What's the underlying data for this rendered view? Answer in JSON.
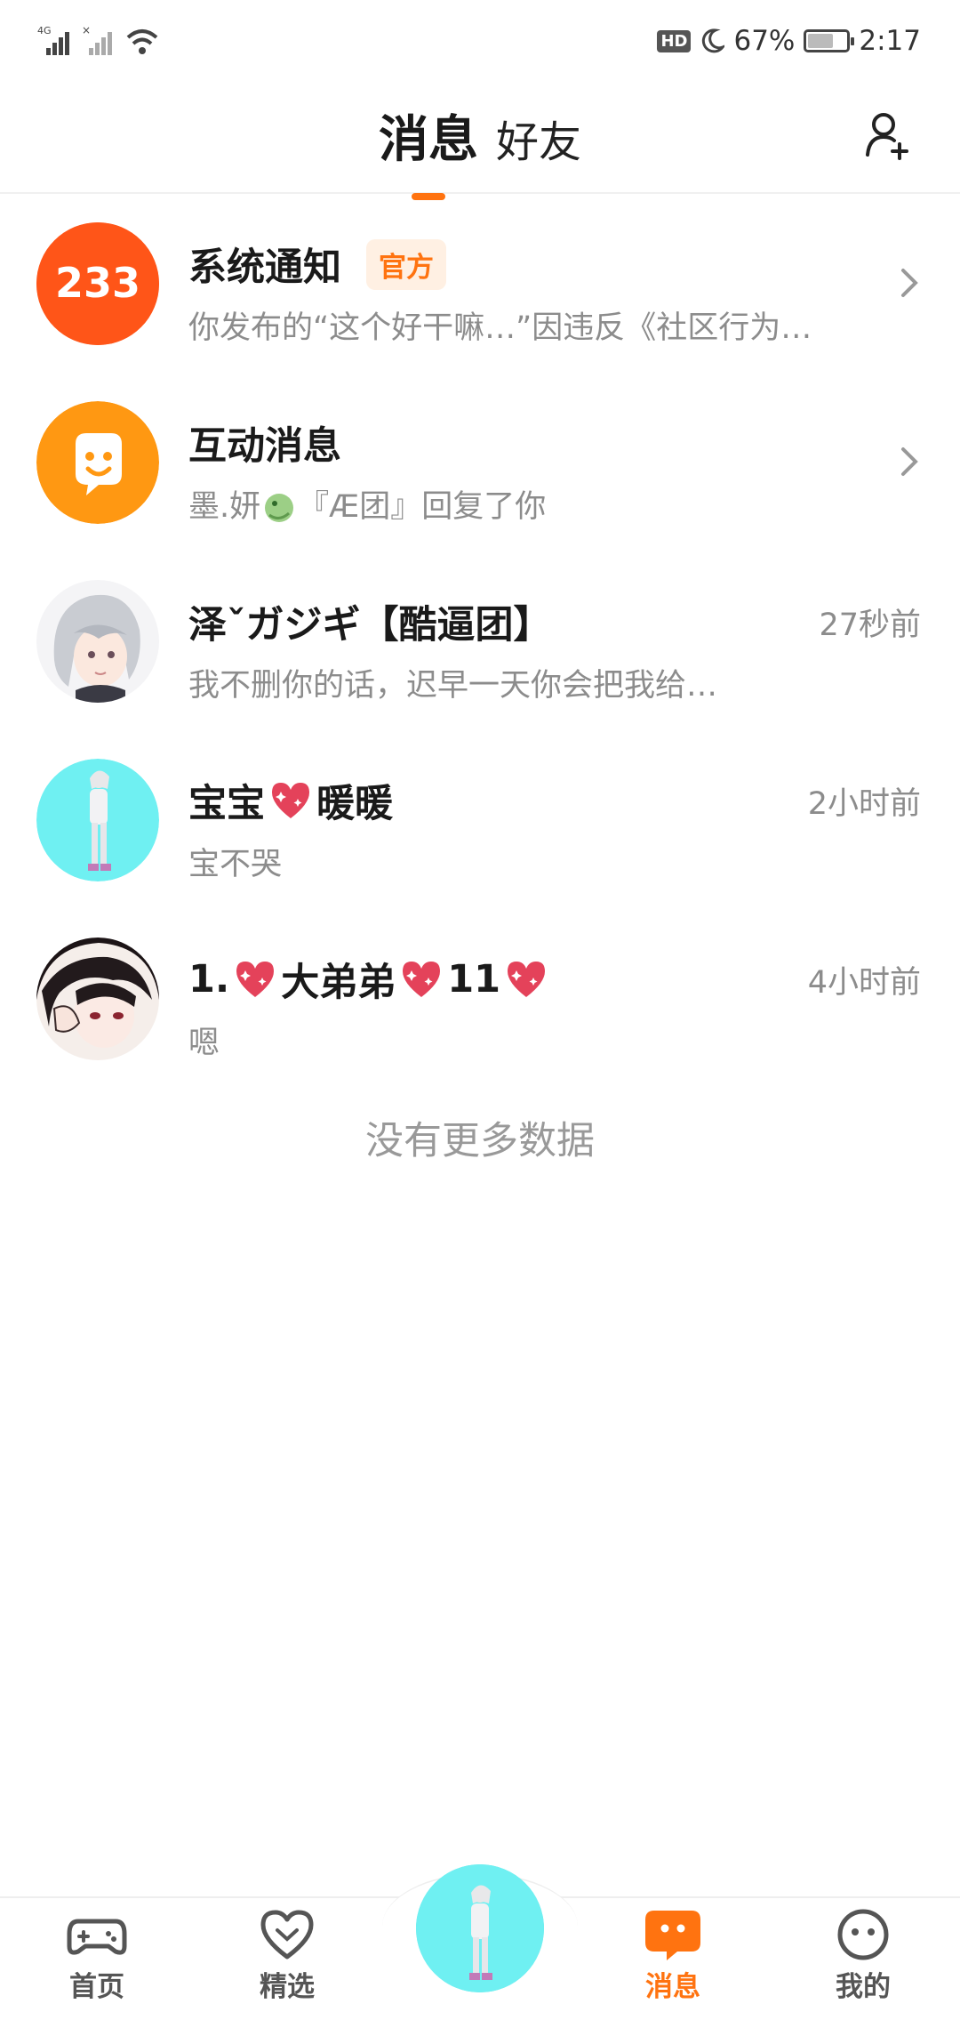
{
  "status_bar": {
    "network": "4G",
    "battery_percent": "67%",
    "battery_level": 0.67,
    "time": "2:17"
  },
  "header": {
    "tabs": [
      {
        "label": "消息",
        "active": true
      },
      {
        "label": "好友",
        "active": false
      }
    ],
    "add_friend_icon": "add-user-icon"
  },
  "messages": [
    {
      "title": "系统通知",
      "badge": "官方",
      "subtitle": "你发布的“这个好干嘛…”因违反《社区行为…",
      "avatar_text": "233"
    },
    {
      "title": "互动消息",
      "subtitle_name": "墨.妍",
      "subtitle_rest": "『Æ团』回复了你"
    },
    {
      "title": "泽ˇガジギ【酷逼团】",
      "subtitle": "我不删你的话，迟早一天你会把我给…",
      "time": "27秒前"
    },
    {
      "title_a": "宝宝",
      "title_b": "暖暖",
      "subtitle": "宝不哭",
      "time": "2小时前"
    },
    {
      "title_a": "1.",
      "title_b": "大弟弟",
      "title_c": "11",
      "subtitle": "嗯",
      "time": "4小时前"
    }
  ],
  "footer_text": "没有更多数据",
  "nav": [
    {
      "label": "首页",
      "icon": "gamepad-icon"
    },
    {
      "label": "精选",
      "icon": "heart-icon"
    },
    {
      "label": "消息",
      "icon": "message-icon",
      "active": true
    },
    {
      "label": "我的",
      "icon": "face-icon"
    }
  ],
  "colors": {
    "accent": "#ff7310",
    "muted_text": "#8c8c8c"
  }
}
